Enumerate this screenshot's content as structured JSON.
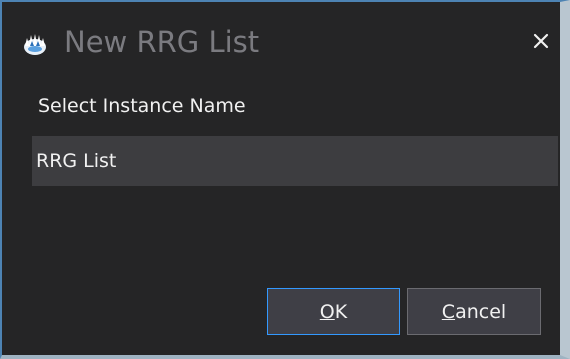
{
  "window": {
    "title": "New RRG List",
    "app_icon": "rrg-app-icon",
    "close_icon": "close-icon"
  },
  "prompt": {
    "label": "Select Instance Name"
  },
  "instance_field": {
    "value": "RRG List"
  },
  "buttons": {
    "ok": {
      "accel": "O",
      "rest": "K"
    },
    "cancel": {
      "accel": "C",
      "rest": "ancel"
    }
  },
  "colors": {
    "background": "#252526",
    "title_text": "#7b7b80",
    "input_background": "#3d3d40",
    "button_background": "#3f3f46",
    "focus_border": "#3399ff"
  }
}
